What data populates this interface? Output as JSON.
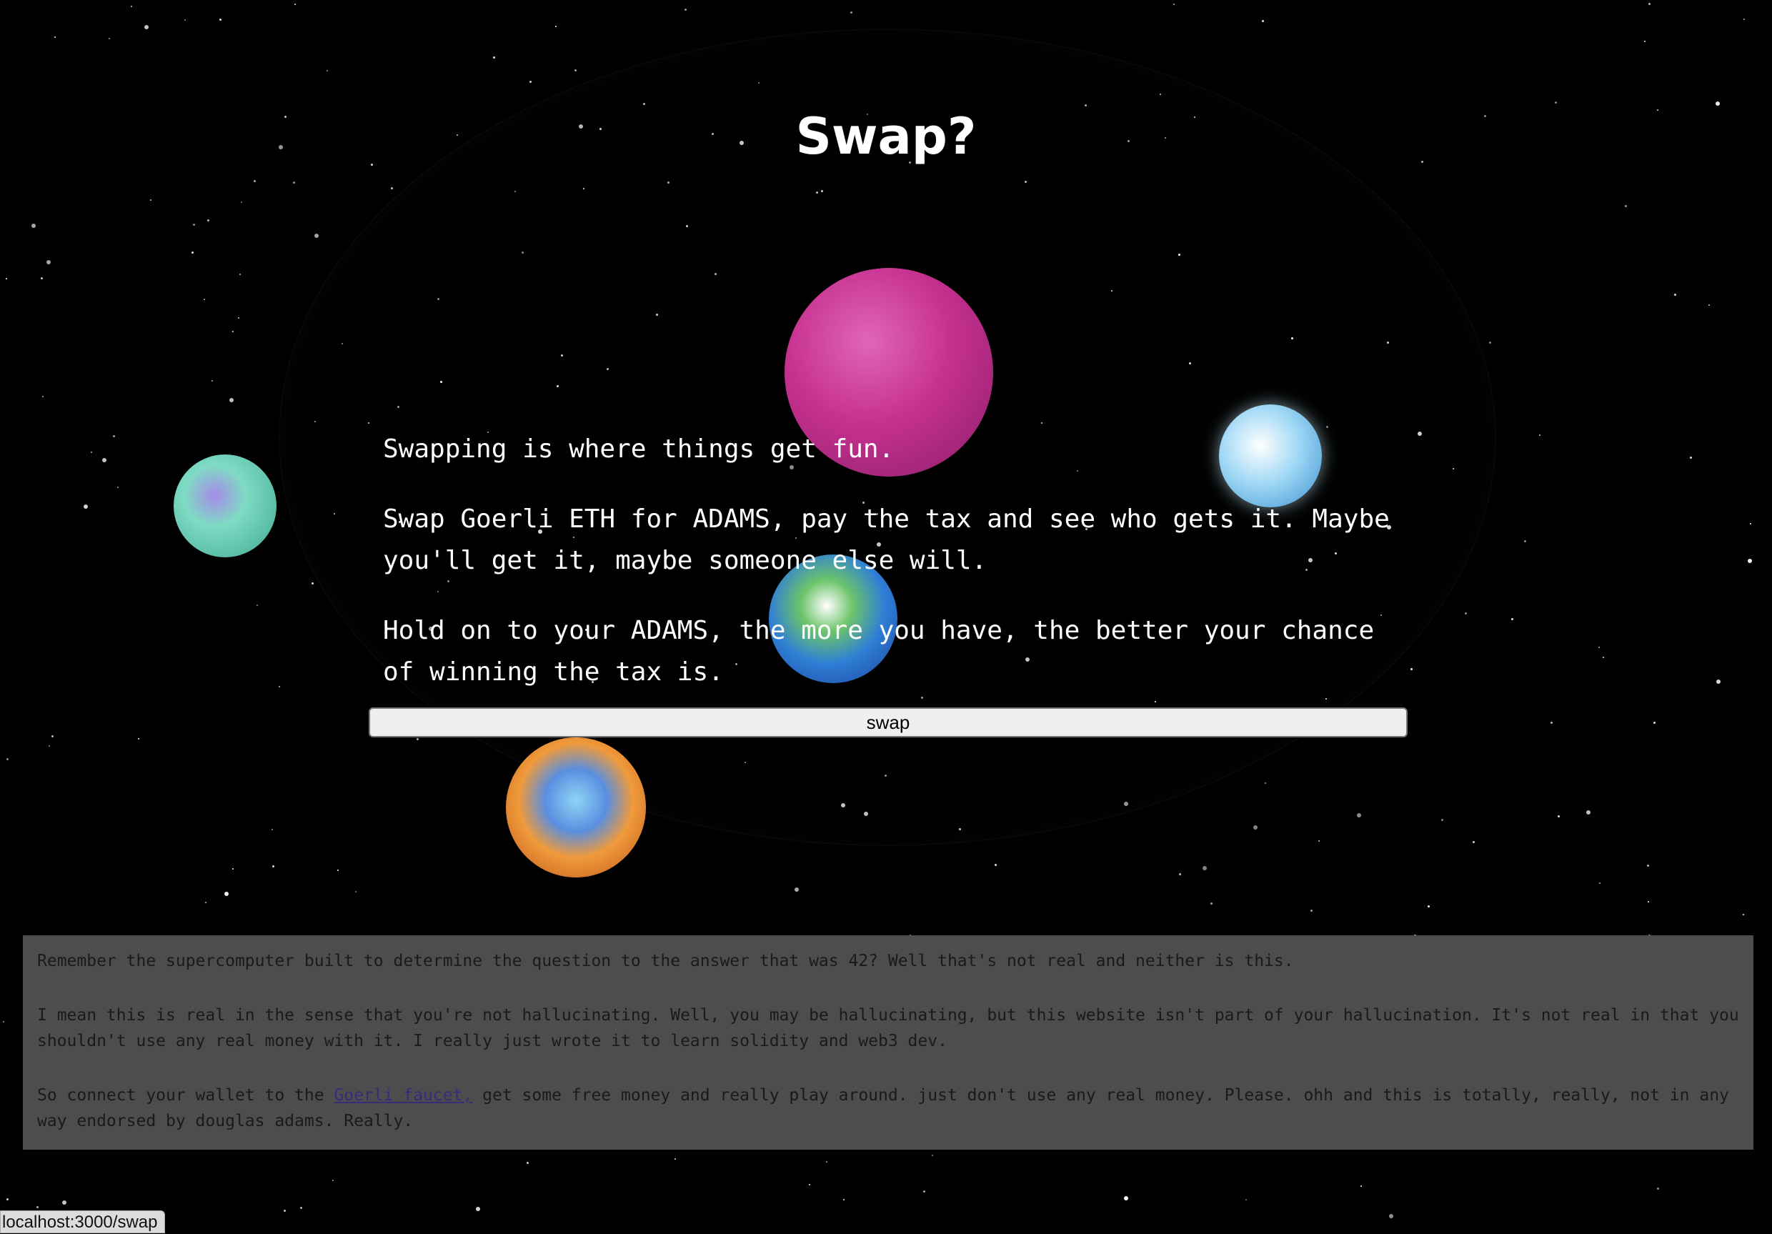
{
  "page": {
    "title": "Swap?",
    "paragraphs": [
      "Swapping is where things get fun.",
      "Swap Goerli ETH for ADAMS, pay the tax and see who gets it. Maybe you'll get it, maybe someone else will.",
      "Hold on to your ADAMS, the more you have, the better your chance of winning the tax is."
    ],
    "swap_button": "swap"
  },
  "footer": {
    "p1": "Remember the supercomputer built to determine the question to the answer that was 42? Well that's not real and neither is this.",
    "p2": "I mean this is real in the sense that you're not hallucinating. Well, you may be hallucinating, but this website isn't part of your hallucination. It's not real in that you shouldn't use any real money with it. I really just wrote it to learn solidity and web3 dev.",
    "p3_before": "So connect your wallet to the ",
    "p3_link": "Goerli faucet,",
    "p3_after": " get some free money and really play around. just don't use any real money. Please. ohh and this is totally, really, not in any way endorsed by douglas adams. Really."
  },
  "status_bar": "localhost:3000/swap",
  "planets": [
    {
      "name": "pink-planet",
      "color": "#c6308f"
    },
    {
      "name": "green-asteroid-planet",
      "color": "#5fd0b3"
    },
    {
      "name": "ice-planet",
      "color": "#8fd0f0"
    },
    {
      "name": "earth-planet",
      "color": "#2f7fd6"
    },
    {
      "name": "orange-planet",
      "color": "#e07a2a"
    }
  ]
}
